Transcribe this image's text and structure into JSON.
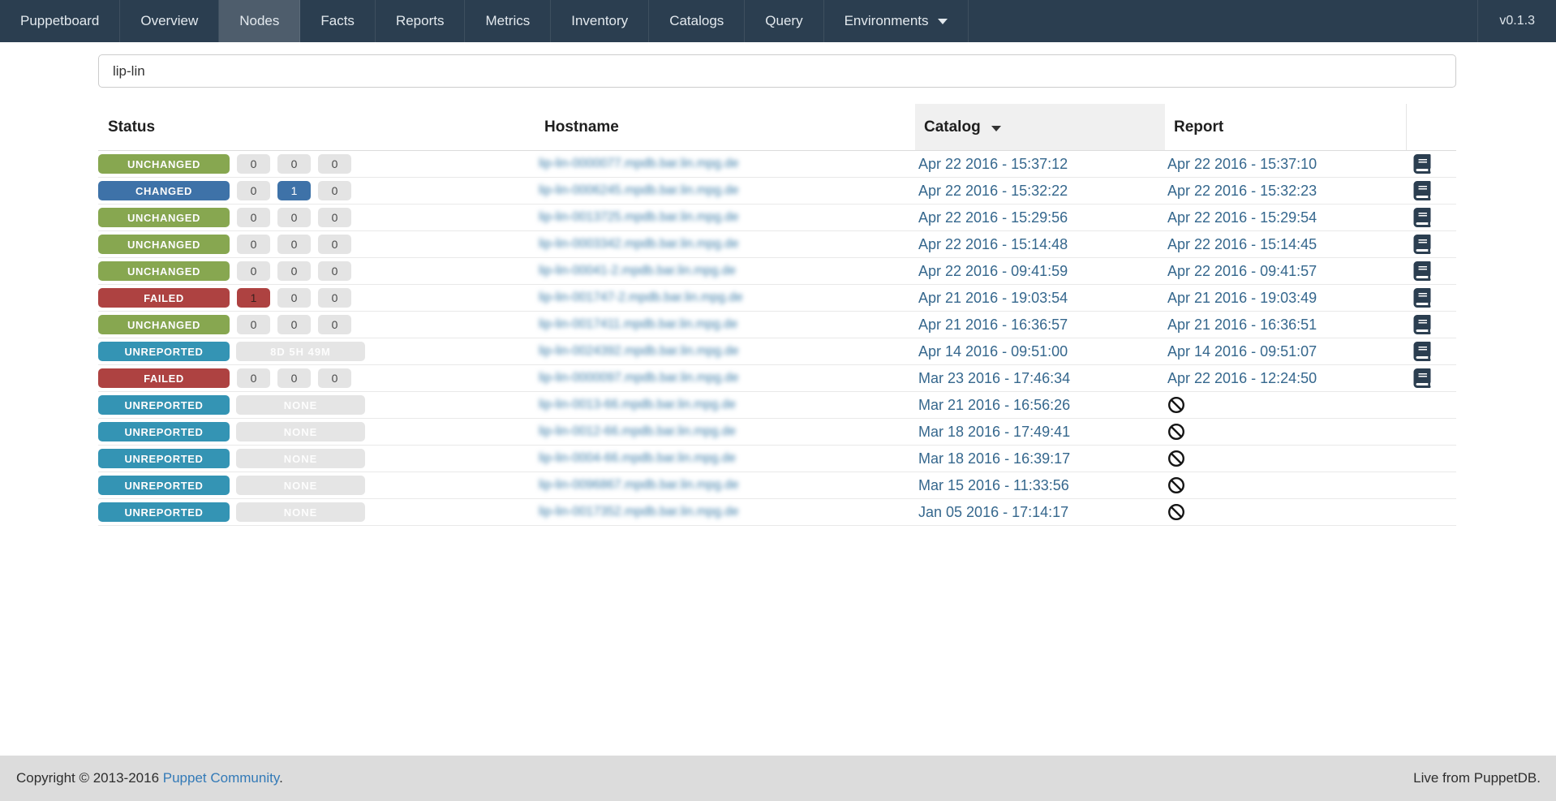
{
  "navbar": {
    "brand": "Puppetboard",
    "items": [
      "Overview",
      "Nodes",
      "Facts",
      "Reports",
      "Metrics",
      "Inventory",
      "Catalogs",
      "Query"
    ],
    "active": "Nodes",
    "environments_label": "Environments",
    "version": "v0.1.3",
    "colors": {
      "background": "#2b3e50",
      "active_background": "#4e5d6c"
    }
  },
  "search": {
    "value": "lip-lin",
    "placeholder": ""
  },
  "table": {
    "headers": {
      "status": "Status",
      "hostname": "Hostname",
      "catalog": "Catalog",
      "report": "Report"
    },
    "sort": {
      "column": "Catalog",
      "direction": "desc",
      "icon": "caret-down-icon"
    },
    "status_colors": {
      "UNCHANGED": "#87a750",
      "CHANGED": "#3e72a8",
      "FAILED": "#ae4241",
      "UNREPORTED": "#3494b4"
    },
    "rows": [
      {
        "status": "UNCHANGED",
        "counts": [
          {
            "v": "0",
            "t": "default"
          },
          {
            "v": "0",
            "t": "default"
          },
          {
            "v": "0",
            "t": "default"
          }
        ],
        "hostname": "lip-lin-0000077.mpdb.bar.lin.mpg.de",
        "catalog_time": "Apr 22 2016 - 15:37:12",
        "report_time": "Apr 22 2016 - 15:37:10",
        "report_icon": "book"
      },
      {
        "status": "CHANGED",
        "counts": [
          {
            "v": "0",
            "t": "default"
          },
          {
            "v": "1",
            "t": "changed"
          },
          {
            "v": "0",
            "t": "default"
          }
        ],
        "hostname": "lip-lin-0006245.mpdb.bar.lin.mpg.de",
        "catalog_time": "Apr 22 2016 - 15:32:22",
        "report_time": "Apr 22 2016 - 15:32:23",
        "report_icon": "book"
      },
      {
        "status": "UNCHANGED",
        "counts": [
          {
            "v": "0",
            "t": "default"
          },
          {
            "v": "0",
            "t": "default"
          },
          {
            "v": "0",
            "t": "default"
          }
        ],
        "hostname": "lip-lin-0013725.mpdb.bar.lin.mpg.de",
        "catalog_time": "Apr 22 2016 - 15:29:56",
        "report_time": "Apr 22 2016 - 15:29:54",
        "report_icon": "book"
      },
      {
        "status": "UNCHANGED",
        "counts": [
          {
            "v": "0",
            "t": "default"
          },
          {
            "v": "0",
            "t": "default"
          },
          {
            "v": "0",
            "t": "default"
          }
        ],
        "hostname": "lip-lin-0003342.mpdb.bar.lin.mpg.de",
        "catalog_time": "Apr 22 2016 - 15:14:48",
        "report_time": "Apr 22 2016 - 15:14:45",
        "report_icon": "book"
      },
      {
        "status": "UNCHANGED",
        "counts": [
          {
            "v": "0",
            "t": "default"
          },
          {
            "v": "0",
            "t": "default"
          },
          {
            "v": "0",
            "t": "default"
          }
        ],
        "hostname": "lip-lin-00041-2.mpdb.bar.lin.mpg.de",
        "catalog_time": "Apr 22 2016 - 09:41:59",
        "report_time": "Apr 22 2016 - 09:41:57",
        "report_icon": "book"
      },
      {
        "status": "FAILED",
        "counts": [
          {
            "v": "1",
            "t": "failed"
          },
          {
            "v": "0",
            "t": "default"
          },
          {
            "v": "0",
            "t": "default"
          }
        ],
        "hostname": "lip-lin-001747-2.mpdb.bar.lin.mpg.de",
        "catalog_time": "Apr 21 2016 - 19:03:54",
        "report_time": "Apr 21 2016 - 19:03:49",
        "report_icon": "book"
      },
      {
        "status": "UNCHANGED",
        "counts": [
          {
            "v": "0",
            "t": "default"
          },
          {
            "v": "0",
            "t": "default"
          },
          {
            "v": "0",
            "t": "default"
          }
        ],
        "hostname": "lip-lin-0017411.mpdb.bar.lin.mpg.de",
        "catalog_time": "Apr 21 2016 - 16:36:57",
        "report_time": "Apr 21 2016 - 16:36:51",
        "report_icon": "book"
      },
      {
        "status": "UNREPORTED",
        "counts_wide": "8D 5H 49M",
        "hostname": "lip-lin-0024392.mpdb.bar.lin.mpg.de",
        "catalog_time": "Apr 14 2016 - 09:51:00",
        "report_time": "Apr 14 2016 - 09:51:07",
        "report_icon": "book"
      },
      {
        "status": "FAILED",
        "counts": [
          {
            "v": "0",
            "t": "default"
          },
          {
            "v": "0",
            "t": "default"
          },
          {
            "v": "0",
            "t": "default"
          }
        ],
        "hostname": "lip-lin-0000097.mpdb.bar.lin.mpg.de",
        "catalog_time": "Mar 23 2016 - 17:46:34",
        "report_time": "Apr 22 2016 - 12:24:50",
        "report_icon": "book"
      },
      {
        "status": "UNREPORTED",
        "counts_wide": "NONE",
        "hostname": "lip-lin-0013-66.mpdb.bar.lin.mpg.de",
        "catalog_time": "Mar 21 2016 - 16:56:26",
        "report_time": null,
        "report_icon": "ban"
      },
      {
        "status": "UNREPORTED",
        "counts_wide": "NONE",
        "hostname": "lip-lin-0012-66.mpdb.bar.lin.mpg.de",
        "catalog_time": "Mar 18 2016 - 17:49:41",
        "report_time": null,
        "report_icon": "ban"
      },
      {
        "status": "UNREPORTED",
        "counts_wide": "NONE",
        "hostname": "lip-lin-0004-66.mpdb.bar.lin.mpg.de",
        "catalog_time": "Mar 18 2016 - 16:39:17",
        "report_time": null,
        "report_icon": "ban"
      },
      {
        "status": "UNREPORTED",
        "counts_wide": "NONE",
        "hostname": "lip-lin-0096867.mpdb.bar.lin.mpg.de",
        "catalog_time": "Mar 15 2016 - 11:33:56",
        "report_time": null,
        "report_icon": "ban"
      },
      {
        "status": "UNREPORTED",
        "counts_wide": "NONE",
        "hostname": "lip-lin-0017352.mpdb.bar.lin.mpg.de",
        "catalog_time": "Jan 05 2016 - 17:14:17",
        "report_time": null,
        "report_icon": "ban"
      }
    ]
  },
  "footer": {
    "copyright_prefix": "Copyright © 2013-2016 ",
    "community_link": "Puppet Community",
    "copyright_suffix": ".",
    "live_text": "Live from PuppetDB."
  }
}
